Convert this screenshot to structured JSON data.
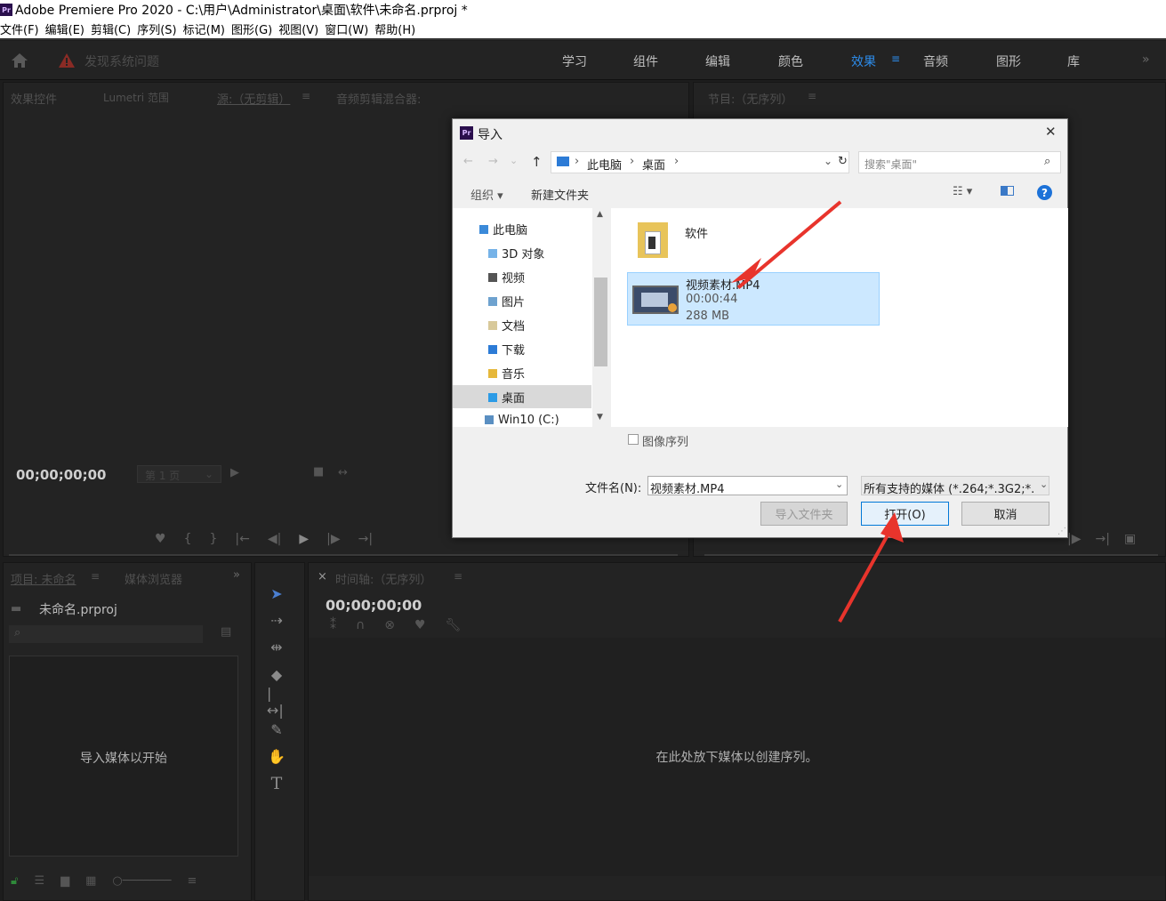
{
  "window": {
    "title": "Adobe Premiere Pro 2020 - C:\\用户\\Administrator\\桌面\\软件\\未命名.prproj *",
    "app_icon": "Pr"
  },
  "menu": [
    "文件(F)",
    "编辑(E)",
    "剪辑(C)",
    "序列(S)",
    "标记(M)",
    "图形(G)",
    "视图(V)",
    "窗口(W)",
    "帮助(H)"
  ],
  "topbar": {
    "warning": "发现系统问题",
    "workspaces": [
      "学习",
      "组件",
      "编辑",
      "颜色",
      "效果",
      "音频",
      "图形",
      "库"
    ],
    "active_workspace": "效果",
    "overflow": "»"
  },
  "source_panel": {
    "tabs": [
      "效果控件",
      "Lumetri 范围",
      "源:（无剪辑）",
      "音频剪辑混合器:"
    ],
    "timecode": "00;00;00;00",
    "page": "第 1 页"
  },
  "program_panel": {
    "tab": "节目:（无序列）"
  },
  "project_panel": {
    "tabs": [
      "项目: 未命名",
      "媒体浏览器"
    ],
    "project_file": "未命名.prproj",
    "empty_text": "导入媒体以开始"
  },
  "timeline_panel": {
    "tab": "时间轴:（无序列）",
    "close": "×",
    "timecode": "00;00;00;00",
    "empty_text": "在此处放下媒体以创建序列。"
  },
  "dialog": {
    "title": "导入",
    "close": "✕",
    "breadcrumb": [
      "此电脑",
      "桌面"
    ],
    "search_placeholder": "搜索\"桌面\"",
    "organize": "组织 ▾",
    "new_folder": "新建文件夹",
    "tree": [
      "此电脑",
      "3D 对象",
      "视频",
      "图片",
      "文档",
      "下载",
      "音乐",
      "桌面",
      "Win10 (C:)"
    ],
    "selected_tree": "桌面",
    "files": [
      {
        "name": "软件"
      },
      {
        "name": "视频素材.MP4",
        "duration": "00:00:44",
        "size": "288 MB"
      }
    ],
    "image_sequence": "图像序列",
    "filename_label": "文件名(N):",
    "filename_value": "视频素材.MP4",
    "filetype": "所有支持的媒体 (*.264;*.3G2;*.",
    "import_folder": "导入文件夹",
    "open": "打开(O)",
    "cancel": "取消"
  },
  "colors": {
    "accent": "#2d8ceb",
    "arrow": "#e8342c",
    "selected": "#cce8ff"
  }
}
